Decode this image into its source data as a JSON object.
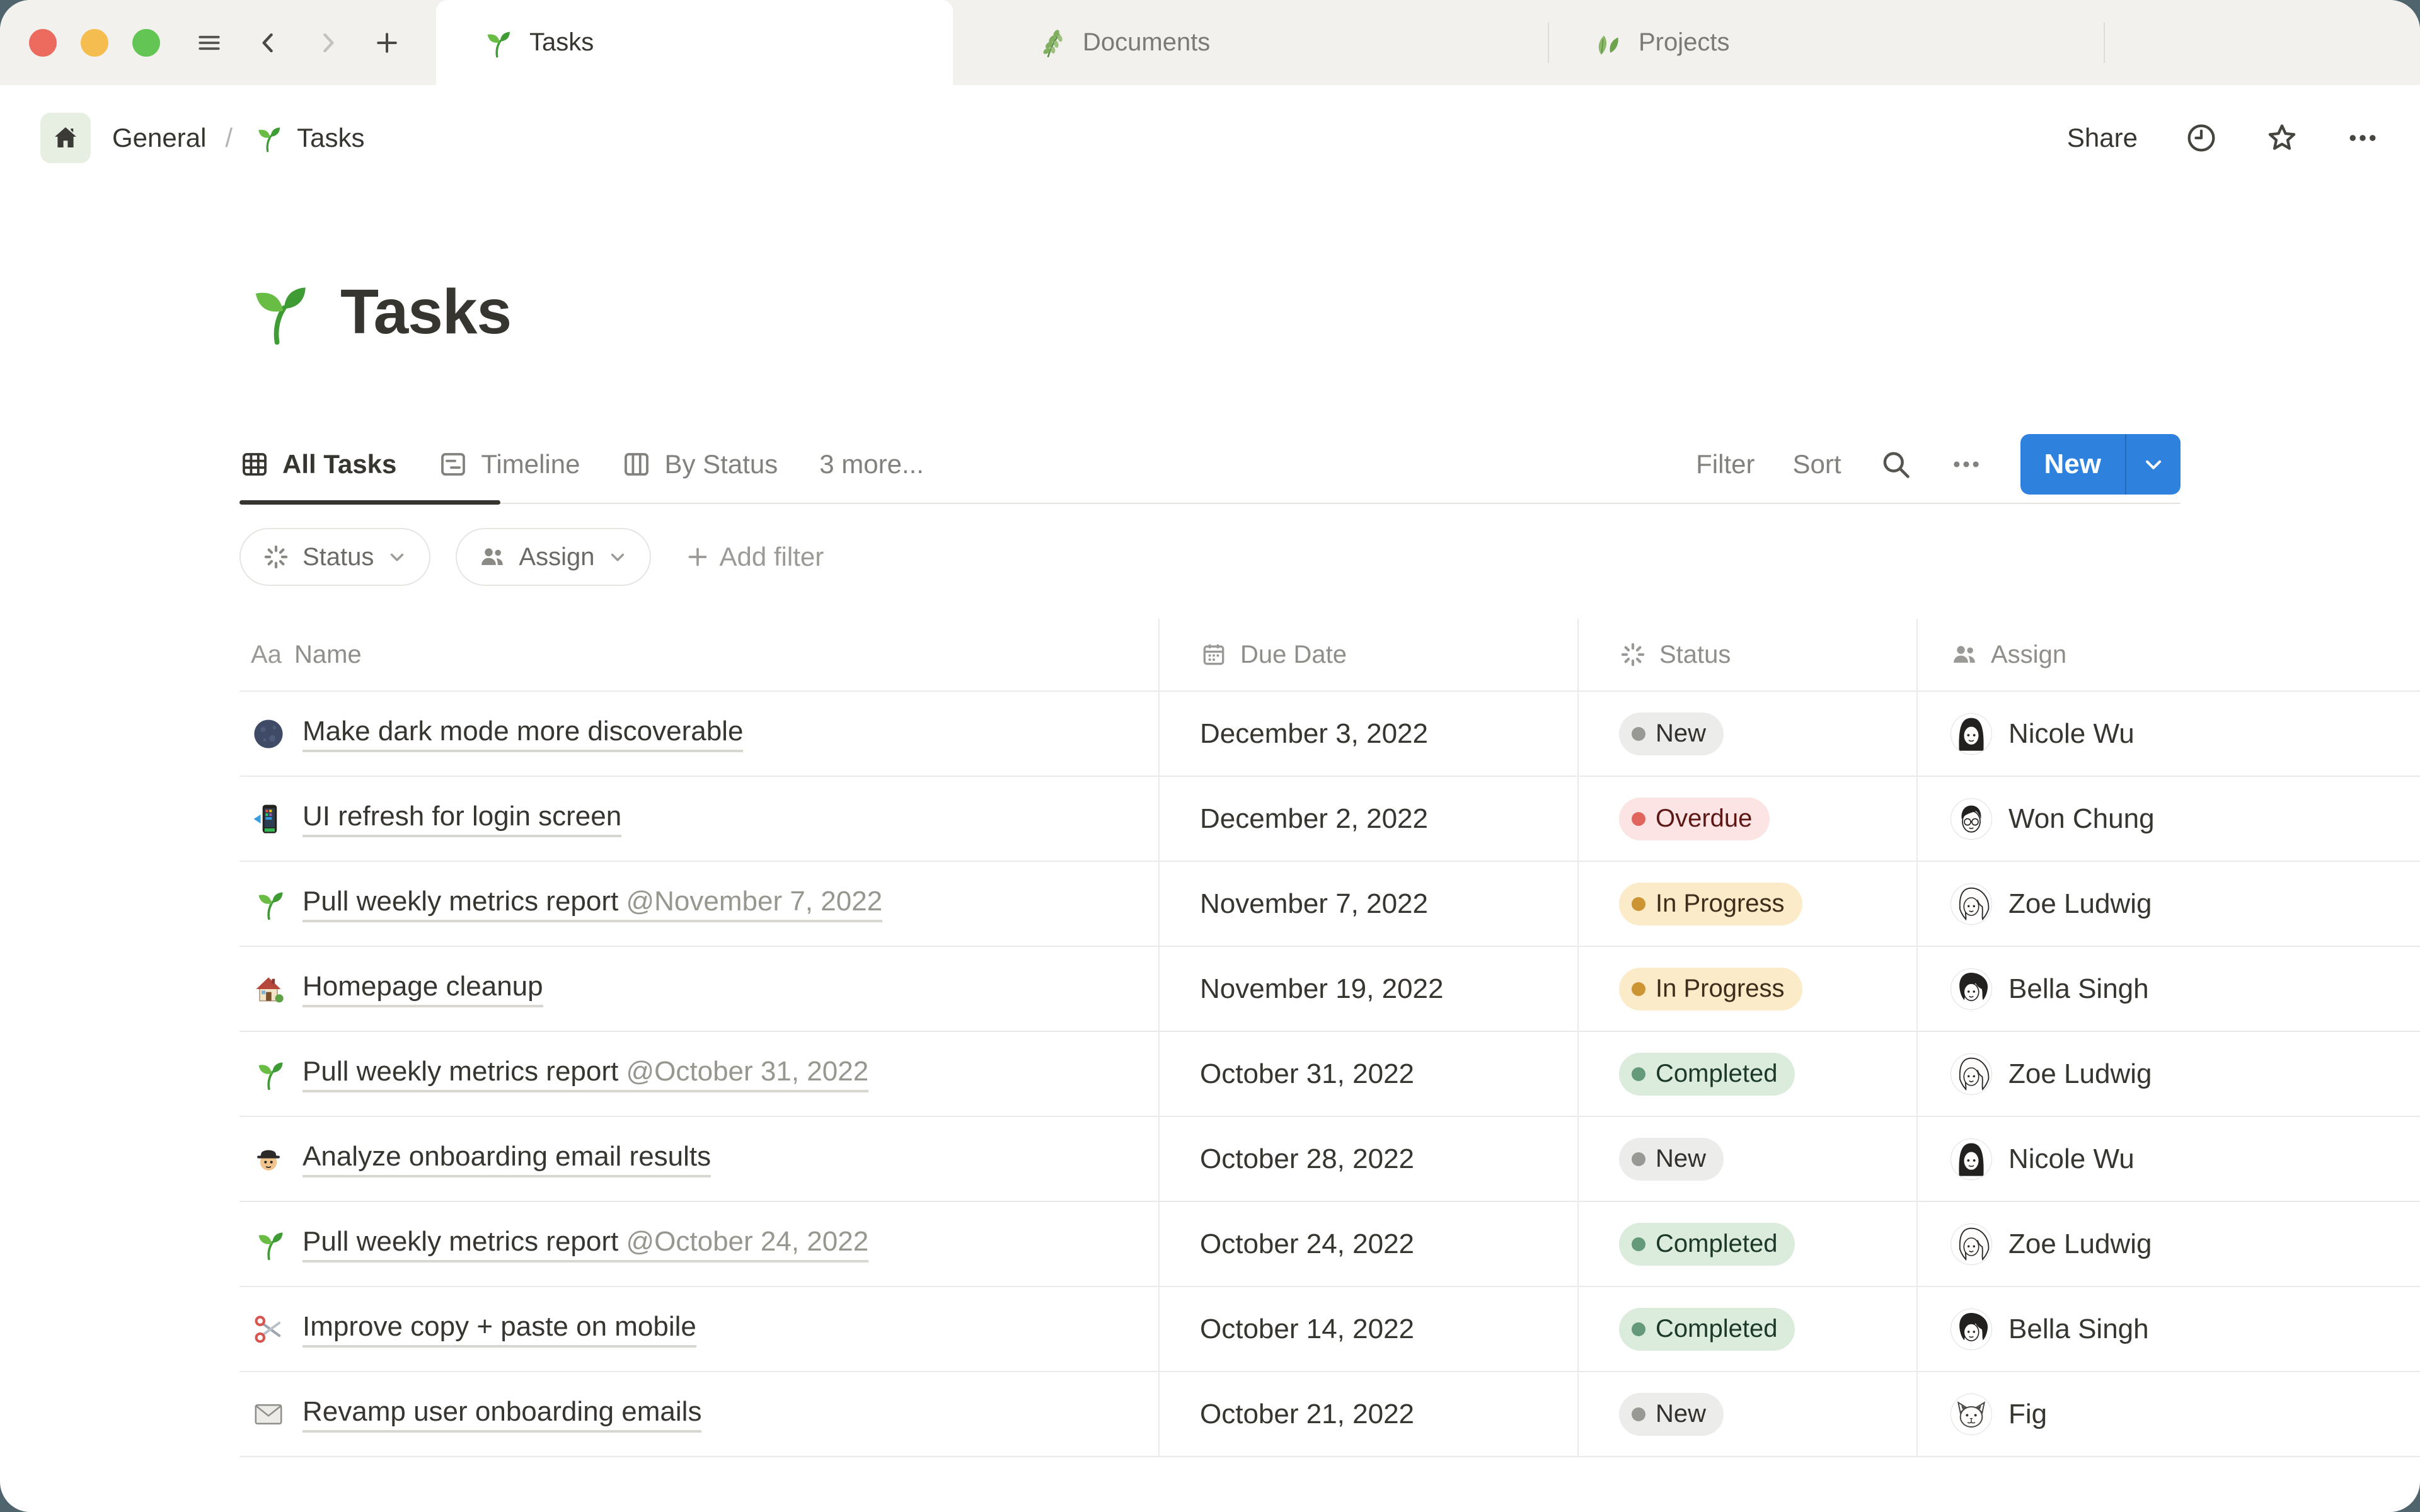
{
  "window": {
    "tabs": [
      {
        "icon": "seedling",
        "label": "Tasks",
        "active": true
      },
      {
        "icon": "herb",
        "label": "Documents",
        "active": false
      },
      {
        "icon": "leaf",
        "label": "Projects",
        "active": false
      }
    ]
  },
  "breadcrumb": {
    "home_label": "General",
    "separator": "/",
    "page_icon": "seedling",
    "page_label": "Tasks",
    "share_label": "Share"
  },
  "page": {
    "icon": "seedling",
    "title": "Tasks"
  },
  "views": {
    "tabs": [
      {
        "icon": "table-view",
        "label": "All Tasks",
        "active": true
      },
      {
        "icon": "timeline-view",
        "label": "Timeline",
        "active": false
      },
      {
        "icon": "board-view",
        "label": "By Status",
        "active": false
      }
    ],
    "more_label": "3 more...",
    "filter_label": "Filter",
    "sort_label": "Sort",
    "new_label": "New"
  },
  "filters": {
    "chips": [
      {
        "icon": "status-burst",
        "label": "Status"
      },
      {
        "icon": "people",
        "label": "Assign"
      }
    ],
    "add_filter_label": "Add filter"
  },
  "table": {
    "columns": [
      {
        "icon_text": "Aa",
        "label": "Name"
      },
      {
        "icon": "calendar",
        "label": "Due Date"
      },
      {
        "icon": "status-burst",
        "label": "Status"
      },
      {
        "icon": "people",
        "label": "Assign"
      }
    ],
    "rows": [
      {
        "icon": "moon",
        "name": "Make dark mode more discoverable",
        "name_suffix": "",
        "due": "December 3, 2022",
        "status": "New",
        "status_color": "gray",
        "assignee": "Nicole Wu",
        "avatar": "nicole"
      },
      {
        "icon": "phone",
        "name": "UI refresh for login screen",
        "name_suffix": "",
        "due": "December 2, 2022",
        "status": "Overdue",
        "status_color": "red",
        "assignee": "Won Chung",
        "avatar": "won"
      },
      {
        "icon": "seedling",
        "name": "Pull weekly metrics report ",
        "name_suffix": "@November 7, 2022",
        "due": "November 7, 2022",
        "status": "In Progress",
        "status_color": "yellow",
        "assignee": "Zoe Ludwig",
        "avatar": "zoe"
      },
      {
        "icon": "house",
        "name": "Homepage cleanup",
        "name_suffix": "",
        "due": "November 19, 2022",
        "status": "In Progress",
        "status_color": "yellow",
        "assignee": "Bella Singh",
        "avatar": "bella"
      },
      {
        "icon": "seedling",
        "name": "Pull weekly metrics report ",
        "name_suffix": "@October 31, 2022",
        "due": "October 31, 2022",
        "status": "Completed",
        "status_color": "green",
        "assignee": "Zoe Ludwig",
        "avatar": "zoe"
      },
      {
        "icon": "detective",
        "name": "Analyze onboarding email results",
        "name_suffix": "",
        "due": "October 28, 2022",
        "status": "New",
        "status_color": "gray",
        "assignee": "Nicole Wu",
        "avatar": "nicole"
      },
      {
        "icon": "seedling",
        "name": "Pull weekly metrics report ",
        "name_suffix": "@October 24, 2022",
        "due": "October 24, 2022",
        "status": "Completed",
        "status_color": "green",
        "assignee": "Zoe Ludwig",
        "avatar": "zoe"
      },
      {
        "icon": "scissors",
        "name": "Improve copy + paste on mobile",
        "name_suffix": "",
        "due": "October 14, 2022",
        "status": "Completed",
        "status_color": "green",
        "assignee": "Bella Singh",
        "avatar": "bella"
      },
      {
        "icon": "envelope",
        "name": "Revamp user onboarding emails",
        "name_suffix": "",
        "due": "October 21, 2022",
        "status": "New",
        "status_color": "gray",
        "assignee": "Fig",
        "avatar": "fig"
      }
    ]
  },
  "colors": {
    "accent_blue": "#2e82dd",
    "window_backdrop": "#50646e",
    "tabbar_bg": "#f2f1ee",
    "traffic_red": "#ed6a5f",
    "traffic_yellow": "#f5bd4f",
    "traffic_green": "#62c554",
    "status_gray_bg": "#ececea",
    "status_gray_dot": "#989894",
    "status_red_bg": "#fbe4e3",
    "status_red_dot": "#e0655c",
    "status_yellow_bg": "#fbebc8",
    "status_yellow_dot": "#cc9433",
    "status_green_bg": "#dbebdc",
    "status_green_dot": "#64997a"
  }
}
